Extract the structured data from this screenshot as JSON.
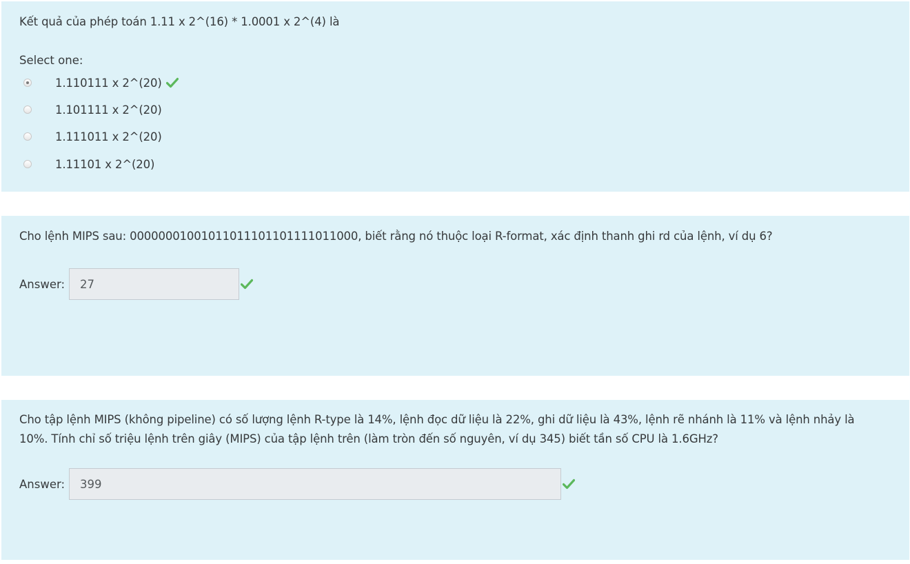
{
  "colors": {
    "question_bg": "#def2f8",
    "correct_check": "#5cb85c",
    "input_bg": "#e9ecef"
  },
  "questions": [
    {
      "text": "Kết quả của phép toán 1.11 x 2^(16) * 1.0001 x 2^(4) là",
      "select_label": "Select one:",
      "options": [
        {
          "label": "1.110111 x 2^(20)",
          "selected": true,
          "correct": true,
          "icon": "check-icon"
        },
        {
          "label": "1.101111 x 2^(20)",
          "selected": false
        },
        {
          "label": "1.111011 x 2^(20)",
          "selected": false
        },
        {
          "label": "1.11101 x 2^(20)",
          "selected": false
        }
      ]
    },
    {
      "text": "Cho lệnh MIPS sau: 00000001001011011101101111011000, biết rằng nó thuộc loại R-format, xác định thanh ghi rd của lệnh, ví dụ 6?",
      "answer_label": "Answer:",
      "answer_value": "27",
      "correct": true,
      "icon": "check-icon"
    },
    {
      "text": "Cho tập lệnh MIPS (không pipeline) có số lượng lệnh R-type là 14%, lệnh đọc dữ liệu là 22%, ghi dữ liệu là 43%, lệnh rẽ nhánh là 11% và lệnh nhảy là 10%. Tính chỉ số triệu lệnh trên giây (MIPS) của tập lệnh trên (làm tròn đến số nguyên, ví dụ 345) biết tần số CPU là 1.6GHz?",
      "answer_label": "Answer:",
      "answer_value": "399",
      "correct": true,
      "icon": "check-icon"
    }
  ]
}
